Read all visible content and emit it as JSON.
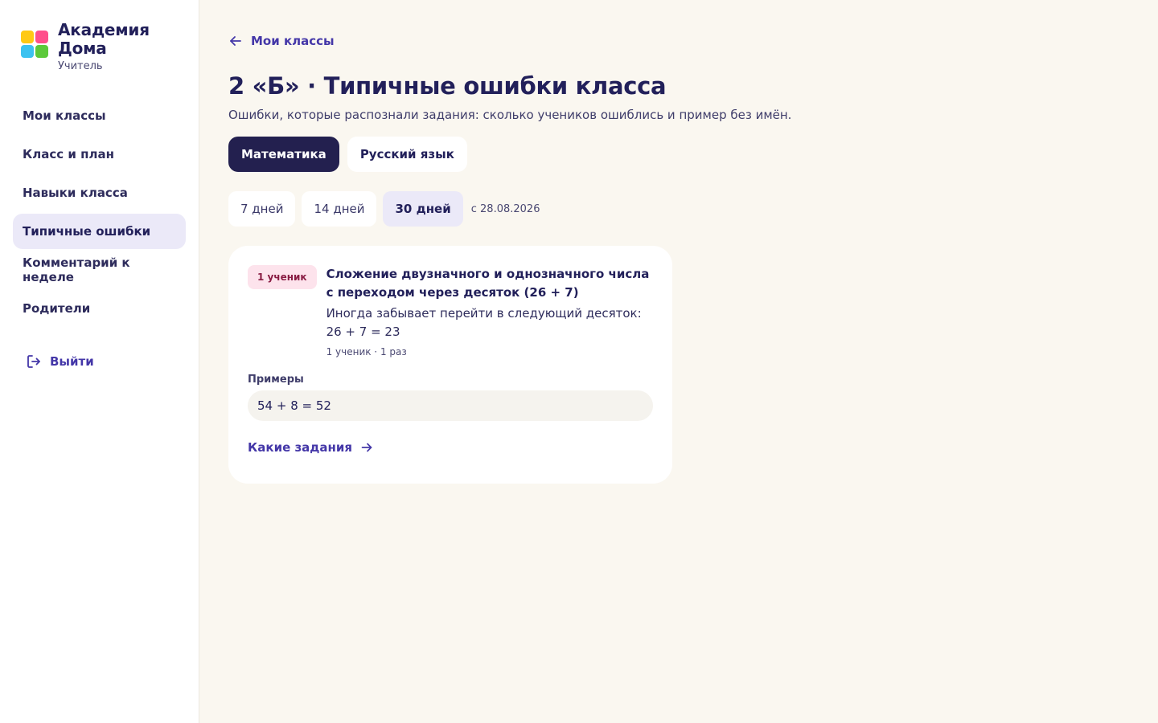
{
  "brand": {
    "name_line1": "Академия",
    "name_line2": "Дома",
    "role": "Учитель"
  },
  "sidebar": {
    "items": [
      {
        "label": "Мои классы",
        "active": false
      },
      {
        "label": "Класс и план",
        "active": false
      },
      {
        "label": "Навыки класса",
        "active": false
      },
      {
        "label": "Типичные ошибки",
        "active": true
      },
      {
        "label": "Комментарий к неделе",
        "active": false
      },
      {
        "label": "Родители",
        "active": false
      }
    ],
    "logout_label": "Выйти"
  },
  "main": {
    "back_label": "Мои классы",
    "title": "2 «Б» · Типичные ошибки класса",
    "subtitle": "Ошибки, которые распознали задания: сколько учеников ошиблись и пример без имён.",
    "subjects": [
      {
        "label": "Математика",
        "active": true
      },
      {
        "label": "Русский язык",
        "active": false
      }
    ],
    "periods": [
      {
        "label": "7 дней",
        "active": false
      },
      {
        "label": "14 дней",
        "active": false
      },
      {
        "label": "30 дней",
        "active": true
      }
    ],
    "period_since": "с 28.08.2026",
    "error_card": {
      "badge": "1 ученик",
      "title": "Сложение двузначного и однозначного числа с переходом через десяток (26 + 7)",
      "description": "Иногда забывает перейти в следующий десяток: 26 + 7 = 23",
      "meta": "1 ученик · 1 раз",
      "examples_label": "Примеры",
      "example": "54 + 8 = 52",
      "tasks_link": "Какие задания"
    }
  },
  "colors": {
    "accent": "#4437a8",
    "dark": "#23204f",
    "active_bg": "#ebe9f8",
    "page_bg": "#faf7f0",
    "badge_bg": "#fde3ec"
  }
}
